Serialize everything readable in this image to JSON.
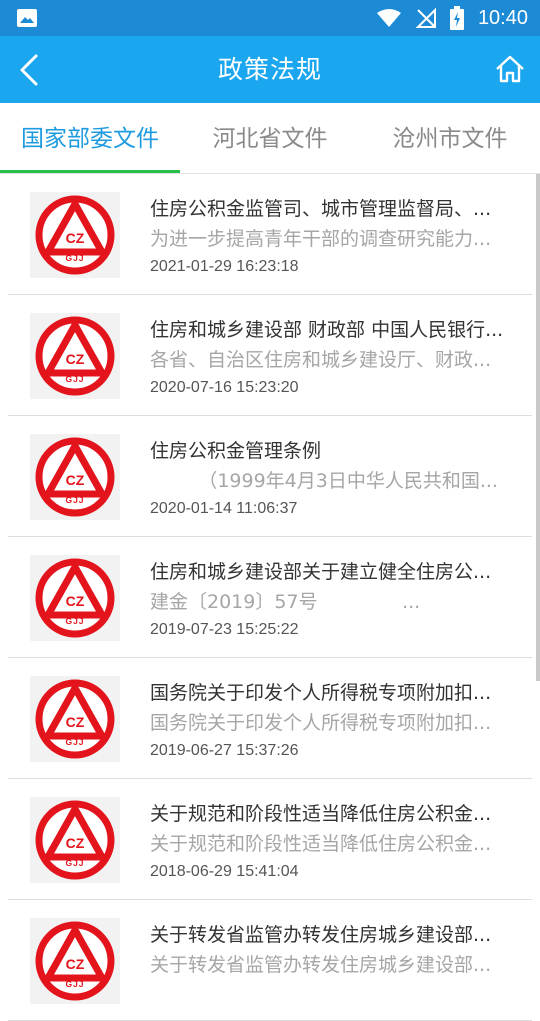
{
  "status_bar": {
    "time": "10:40"
  },
  "header": {
    "title": "政策法规"
  },
  "tabs": [
    {
      "label": "国家部委文件",
      "active": true
    },
    {
      "label": "河北省文件",
      "active": false
    },
    {
      "label": "沧州市文件",
      "active": false
    }
  ],
  "logo": {
    "top_text": "CZ",
    "bottom_text": "GJJ"
  },
  "items": [
    {
      "title": "住房公积金监管司、城市管理监督局、...",
      "subtitle": "为进一步提高青年干部的调查研究能力...",
      "date": "2021-01-29 16:23:18"
    },
    {
      "title": "住房和城乡建设部 财政部 中国人民银行...",
      "subtitle": "各省、自治区住房和城乡建设厅、财政...",
      "date": "2020-07-16 15:23:20"
    },
    {
      "title": "住房公积金管理条例",
      "subtitle": "        （1999年4月3日中华人民共和国...",
      "date": "2020-01-14 11:06:37"
    },
    {
      "title": "住房和城乡建设部关于建立健全住房公...",
      "subtitle": "建金〔2019〕57号              ...",
      "date": "2019-07-23 15:25:22"
    },
    {
      "title": "国务院关于印发个人所得税专项附加扣...",
      "subtitle": "国务院关于印发个人所得税专项附加扣...",
      "date": "2019-06-27 15:37:26"
    },
    {
      "title": "关于规范和阶段性适当降低住房公积金...",
      "subtitle": "关于规范和阶段性适当降低住房公积金...",
      "date": "2018-06-29 15:41:04"
    },
    {
      "title": "关于转发省监管办转发住房城乡建设部...",
      "subtitle": "关于转发省监管办转发住房城乡建设部...",
      "date": ""
    }
  ]
}
